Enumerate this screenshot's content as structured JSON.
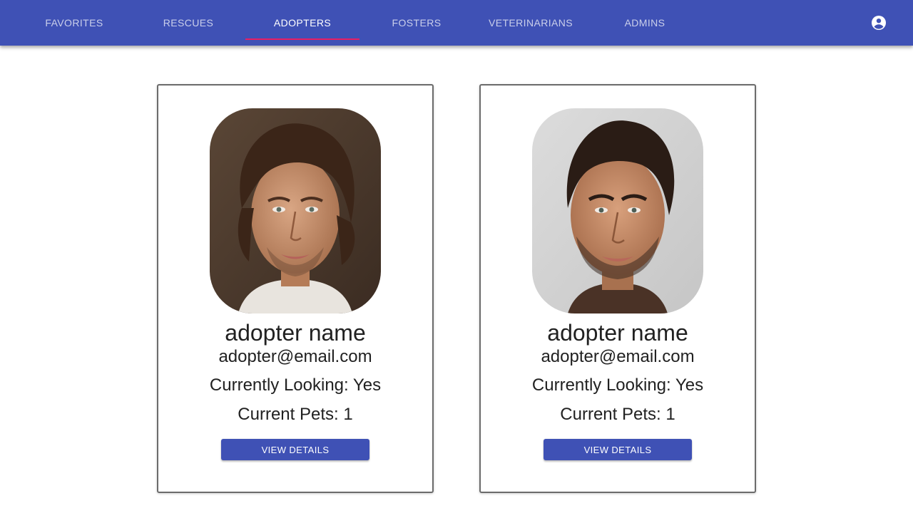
{
  "nav": {
    "tabs": [
      {
        "label": "FAVORITES"
      },
      {
        "label": "RESCUES"
      },
      {
        "label": "ADOPTERS"
      },
      {
        "label": "FOSTERS"
      },
      {
        "label": "VETERINARIANS"
      },
      {
        "label": "ADMINS"
      }
    ],
    "active_tab": "ADOPTERS",
    "account_icon": "account-circle-icon"
  },
  "colors": {
    "app_bar": "#3f51b5",
    "tab_indicator": "#e91e63",
    "button": "#3f51b5"
  },
  "adopters": [
    {
      "name": "adopter name",
      "email": "adopter@email.com",
      "looking": "Currently Looking: Yes",
      "pets": "Current Pets: 1",
      "button_label": "VIEW DETAILS"
    },
    {
      "name": "adopter name",
      "email": "adopter@email.com",
      "looking": "Currently Looking: Yes",
      "pets": "Current Pets: 1",
      "button_label": "VIEW DETAILS"
    }
  ]
}
